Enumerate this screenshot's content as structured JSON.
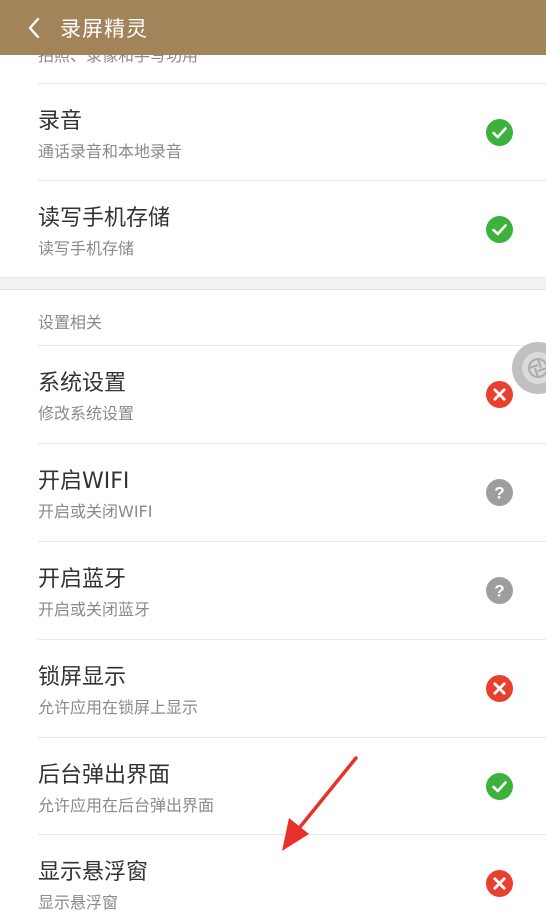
{
  "header": {
    "title": "录屏精灵",
    "back_icon": "chevron-left-icon"
  },
  "partial_row": {
    "text": "拍照、录像和手写功用"
  },
  "permissions_top": [
    {
      "title": "录音",
      "desc": "通话录音和本地录音",
      "status": "granted"
    },
    {
      "title": "读写手机存储",
      "desc": "读写手机存储",
      "status": "granted"
    }
  ],
  "section": {
    "header": "设置相关"
  },
  "permissions_settings": [
    {
      "title": "系统设置",
      "desc": "修改系统设置",
      "status": "denied"
    },
    {
      "title": "开启WIFI",
      "desc": "开启或关闭WIFI",
      "status": "unknown"
    },
    {
      "title": "开启蓝牙",
      "desc": "开启或关闭蓝牙",
      "status": "unknown"
    },
    {
      "title": "锁屏显示",
      "desc": "允许应用在锁屏上显示",
      "status": "denied"
    },
    {
      "title": "后台弹出界面",
      "desc": "允许应用在后台弹出界面",
      "status": "granted"
    },
    {
      "title": "显示悬浮窗",
      "desc": "显示悬浮窗",
      "status": "denied"
    }
  ],
  "colors": {
    "header_bg": "#a2835a",
    "granted": "#3cb13c",
    "denied": "#e8402e",
    "unknown": "#9e9e9e",
    "arrow": "#e8312a"
  }
}
